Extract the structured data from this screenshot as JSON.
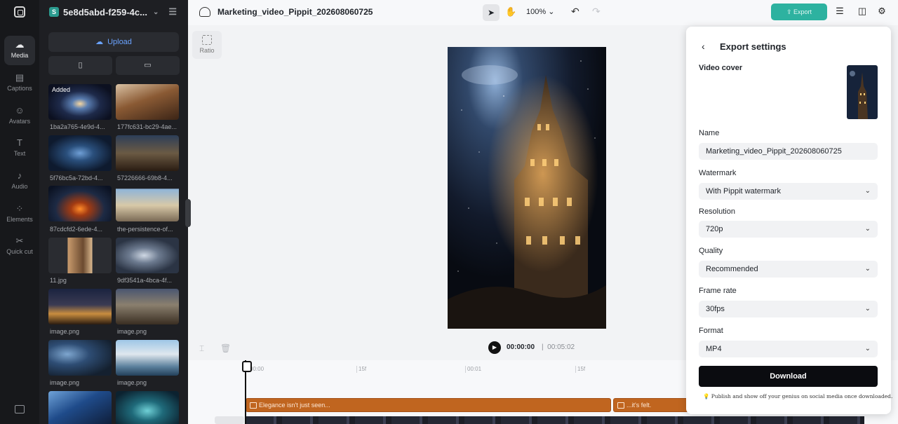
{
  "sidebar": {
    "items": [
      {
        "label": "Media",
        "icon": "cloud-media-icon"
      },
      {
        "label": "Captions",
        "icon": "captions-icon"
      },
      {
        "label": "Avatars",
        "icon": "avatar-icon"
      },
      {
        "label": "Text",
        "icon": "text-icon"
      },
      {
        "label": "Audio",
        "icon": "music-icon"
      },
      {
        "label": "Elements",
        "icon": "elements-icon"
      },
      {
        "label": "Quick cut",
        "icon": "quick-cut-icon"
      }
    ]
  },
  "project": {
    "badge": "S",
    "name": "5e8d5abd-f259-4c..."
  },
  "media": {
    "upload_label": "Upload",
    "added_badge": "Added",
    "items": [
      {
        "label": "1ba2a765-4e9d-4..."
      },
      {
        "label": "177fc631-bc29-4ae..."
      },
      {
        "label": "5f76bc5a-72bd-4..."
      },
      {
        "label": "57226666-69b8-4..."
      },
      {
        "label": "87cdcfd2-6ede-4..."
      },
      {
        "label": "the-persistence-of..."
      },
      {
        "label": "11.jpg"
      },
      {
        "label": "9df3541a-4bca-4f..."
      },
      {
        "label": "image.png"
      },
      {
        "label": "image.png"
      },
      {
        "label": "image.png"
      },
      {
        "label": "image.png"
      },
      {
        "label": ""
      },
      {
        "label": ""
      }
    ]
  },
  "topbar": {
    "title": "Marketing_video_Pippit_202608060725",
    "zoom": "100%",
    "export_label": "Export"
  },
  "canvas": {
    "ratio_label": "Ratio"
  },
  "playback": {
    "current_time": "00:00:00",
    "separator": "|",
    "duration": "00:05:02"
  },
  "timeline": {
    "ticks": [
      "00:00",
      "15f",
      "00:01",
      "15f"
    ],
    "clips": [
      {
        "text": "Elegance isn't just seen..."
      },
      {
        "text": "...it's felt."
      }
    ]
  },
  "export": {
    "title": "Export settings",
    "cover_label": "Video cover",
    "name_label": "Name",
    "name_value": "Marketing_video_Pippit_202608060725",
    "watermark_label": "Watermark",
    "watermark_value": "With Pippit watermark",
    "resolution_label": "Resolution",
    "resolution_value": "720p",
    "quality_label": "Quality",
    "quality_value": "Recommended",
    "framerate_label": "Frame rate",
    "framerate_value": "30fps",
    "format_label": "Format",
    "format_value": "MP4",
    "download_label": "Download",
    "note": "Publish and show off your genius on social media once downloaded."
  },
  "colors": {
    "accent": "#2db2a0",
    "caption_clip": "#c0651f",
    "link_blue": "#6aa3ff"
  }
}
